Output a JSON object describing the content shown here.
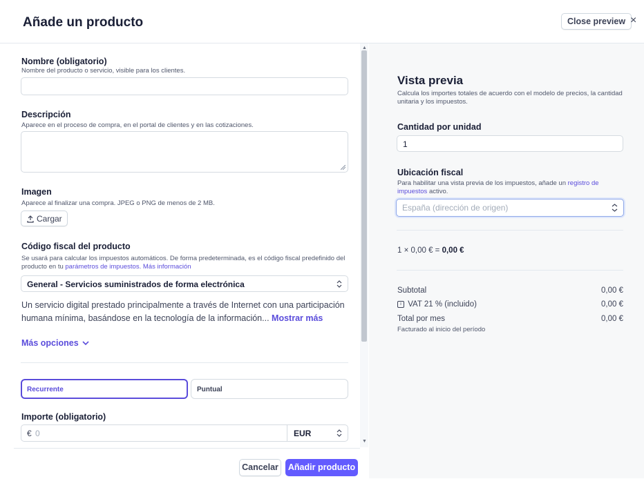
{
  "header": {
    "title": "Añade un producto",
    "close_preview_label": "Close preview",
    "close_icon": "×"
  },
  "form": {
    "name": {
      "label": "Nombre (obligatorio)",
      "help": "Nombre del producto o servicio, visible para los clientes.",
      "value": ""
    },
    "description": {
      "label": "Descripción",
      "help": "Aparece en el proceso de compra, en el portal de clientes y en las cotizaciones.",
      "value": ""
    },
    "image": {
      "label": "Imagen",
      "help": "Aparece al finalizar una compra. JPEG o PNG de menos de 2 MB.",
      "upload_label": "Cargar"
    },
    "tax_code": {
      "label": "Código fiscal del producto",
      "help_text": "Se usará para calcular los impuestos automáticos. De forma predeterminada, es el código fiscal predefinido del producto en tu",
      "help_link1": "parámetros de impuestos.",
      "help_link2": "Más información",
      "selected": "General - Servicios suministrados de forma electrónica",
      "description": "Un servicio digital prestado principalmente a través de Internet con una participación humana mínima, basándose en la tecnología de la información...",
      "show_more": "Mostrar más"
    },
    "more_options": "Más opciones",
    "pricing_tabs": [
      "Recurrente",
      "Puntual"
    ],
    "amount": {
      "label": "Importe (obligatorio)",
      "currency_symbol": "€",
      "placeholder": "0",
      "currency": "EUR"
    }
  },
  "footer": {
    "cancel_label": "Cancelar",
    "add_label": "Añadir producto"
  },
  "preview": {
    "title": "Vista previa",
    "subtitle": "Calcula los importes totales de acuerdo con el modelo de precios, la cantidad unitaria y los impuestos.",
    "quantity_label": "Cantidad por unidad",
    "quantity_value": "1",
    "tax_location_label": "Ubicación fiscal",
    "tax_location_help_pre": "Para habilitar una vista previa de los impuestos, añade un",
    "tax_location_help_link": "registro de impuestos",
    "tax_location_help_post": "activo.",
    "tax_location_placeholder": "España (dirección de origen)",
    "calc_line": "1 × 0,00 € =",
    "calc_result": "0,00 €",
    "subtotal_label": "Subtotal",
    "subtotal_value": "0,00 €",
    "vat_label": "VAT 21 % (incluido)",
    "vat_value": "0,00 €",
    "total_label": "Total por mes",
    "total_value": "0,00 €",
    "total_note": "Facturado al inicio del período"
  },
  "colors": {
    "accent": "#635bff",
    "link": "#5a4cdb",
    "preview_bg": "#f7f8f9",
    "focus_border": "#8fa8e8"
  }
}
